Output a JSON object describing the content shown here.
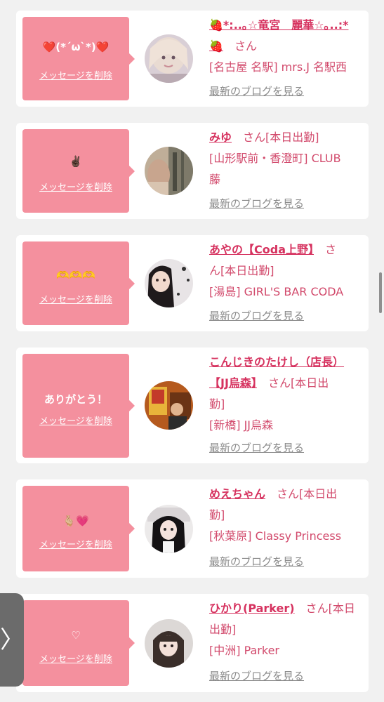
{
  "colors": {
    "message_box": "#f4909e",
    "name_link": "#d6325f",
    "text_pink": "#d24a6c",
    "blog_link": "#8a8a8a",
    "side_tab": "#6b6b6b"
  },
  "side_tab_label": "〉",
  "cards": [
    {
      "message": "❤️(*´ω`*)❤️",
      "delete_label": "メッセージを削除",
      "name_line1": "🍓*:..｡☆竜宮　麗華☆｡..:*",
      "name_line2": "🍓",
      "san": "さん",
      "status": "",
      "shop": "[名古屋 名駅] mrs.J 名駅西",
      "blog_label": "最新のブログを見る"
    },
    {
      "message": "✌🏿",
      "delete_label": "メッセージを削除",
      "name_line1": "みゆ",
      "san": "さん",
      "status": "[本日出勤]",
      "shop_line1": "[山形駅前・香澄町] CLUB",
      "shop_line2": "藤",
      "blog_label": "最新のブログを見る"
    },
    {
      "message": "🫶🫶🫶",
      "delete_label": "メッセージを削除",
      "name_line1": "あやの【Coda上野】",
      "san_part1": "さ",
      "san_part2": "ん",
      "status": "[本日出勤]",
      "shop": "[湯島] GIRL'S BAR CODA",
      "blog_label": "最新のブログを見る"
    },
    {
      "message": "ありがとう！",
      "delete_label": "メッセージを削除",
      "name_line1": "こんじきのたけし（店長）",
      "name_line2": "【JJ烏森】",
      "san": "さん",
      "status_part1": "[本日出",
      "status_part2": "勤]",
      "shop": "[新橋] JJ烏森",
      "blog_label": "最新のブログを見る"
    },
    {
      "message": "🫰🏼💗",
      "delete_label": "メッセージを削除",
      "name_line1": "めえちゃん",
      "san": "さん",
      "status_part1": "[本日出",
      "status_part2": "勤]",
      "shop": "[秋葉原] Classy Princess",
      "blog_label": "最新のブログを見る"
    },
    {
      "message": "♡",
      "delete_label": "メッセージを削除",
      "name_line1": "ひかり(Parker)",
      "san": "さん",
      "status_part1": "[本日",
      "status_part2": "出勤]",
      "shop": "[中洲] Parker",
      "blog_label": "最新のブログを見る"
    }
  ]
}
